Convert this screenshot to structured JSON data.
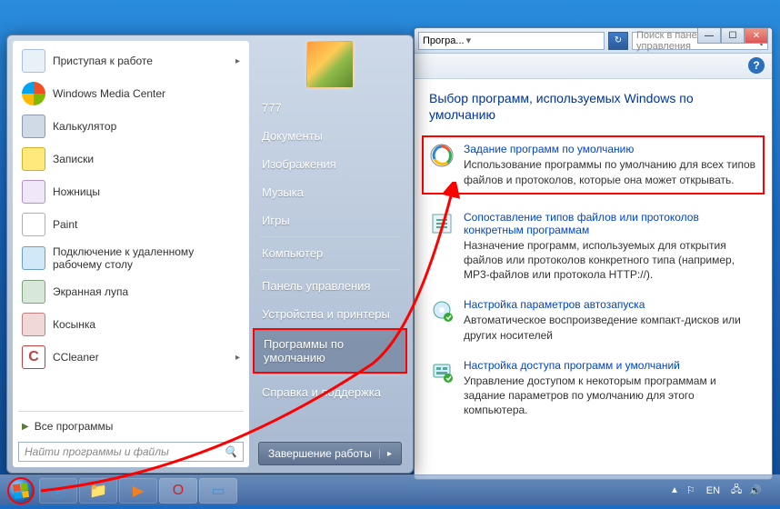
{
  "cp": {
    "breadcrumb": "Програ...",
    "search_placeholder": "Поиск в панели управления",
    "heading": "Выбор программ, используемых Windows по умолчанию",
    "items": [
      {
        "link": "Задание программ по умолчанию",
        "desc": "Использование программы по умолчанию для всех типов файлов и протоколов, которые она может открывать."
      },
      {
        "link": "Сопоставление типов файлов или протоколов конкретным программам",
        "desc": "Назначение программ, используемых для открытия файлов или протоколов конкретного типа (например, MP3-файлов  или протокола HTTP://)."
      },
      {
        "link": "Настройка параметров автозапуска",
        "desc": "Автоматическое воспроизведение компакт-дисков или других носителей"
      },
      {
        "link": "Настройка доступа программ и умолчаний",
        "desc": "Управление доступом к некоторым программам и задание параметров по умолчанию для этого компьютера."
      }
    ]
  },
  "start": {
    "programs": [
      {
        "label": "Приступая к работе",
        "icon": "ico-boxed",
        "sub": true
      },
      {
        "label": "Windows Media Center",
        "icon": "ico-win"
      },
      {
        "label": "Калькулятор",
        "icon": "ico-calc"
      },
      {
        "label": "Записки",
        "icon": "ico-sticky"
      },
      {
        "label": "Ножницы",
        "icon": "ico-snip"
      },
      {
        "label": "Paint",
        "icon": "ico-paint"
      },
      {
        "label": "Подключение к удаленному рабочему столу",
        "icon": "ico-rdp"
      },
      {
        "label": "Экранная лупа",
        "icon": "ico-mag"
      },
      {
        "label": "Косынка",
        "icon": "ico-cards"
      },
      {
        "label": "CCleaner",
        "icon": "ico-cc",
        "sub": true
      }
    ],
    "all_programs": "Все программы",
    "search_placeholder": "Найти программы и файлы",
    "username": "777",
    "right": [
      "Документы",
      "Изображения",
      "Музыка",
      "Игры",
      "Компьютер",
      "Панель управления",
      "Устройства и принтеры",
      "Программы по умолчанию",
      "Справка и поддержка"
    ],
    "shutdown": "Завершение работы"
  },
  "taskbar": {
    "lang": "EN",
    "time": "",
    "date": ""
  }
}
